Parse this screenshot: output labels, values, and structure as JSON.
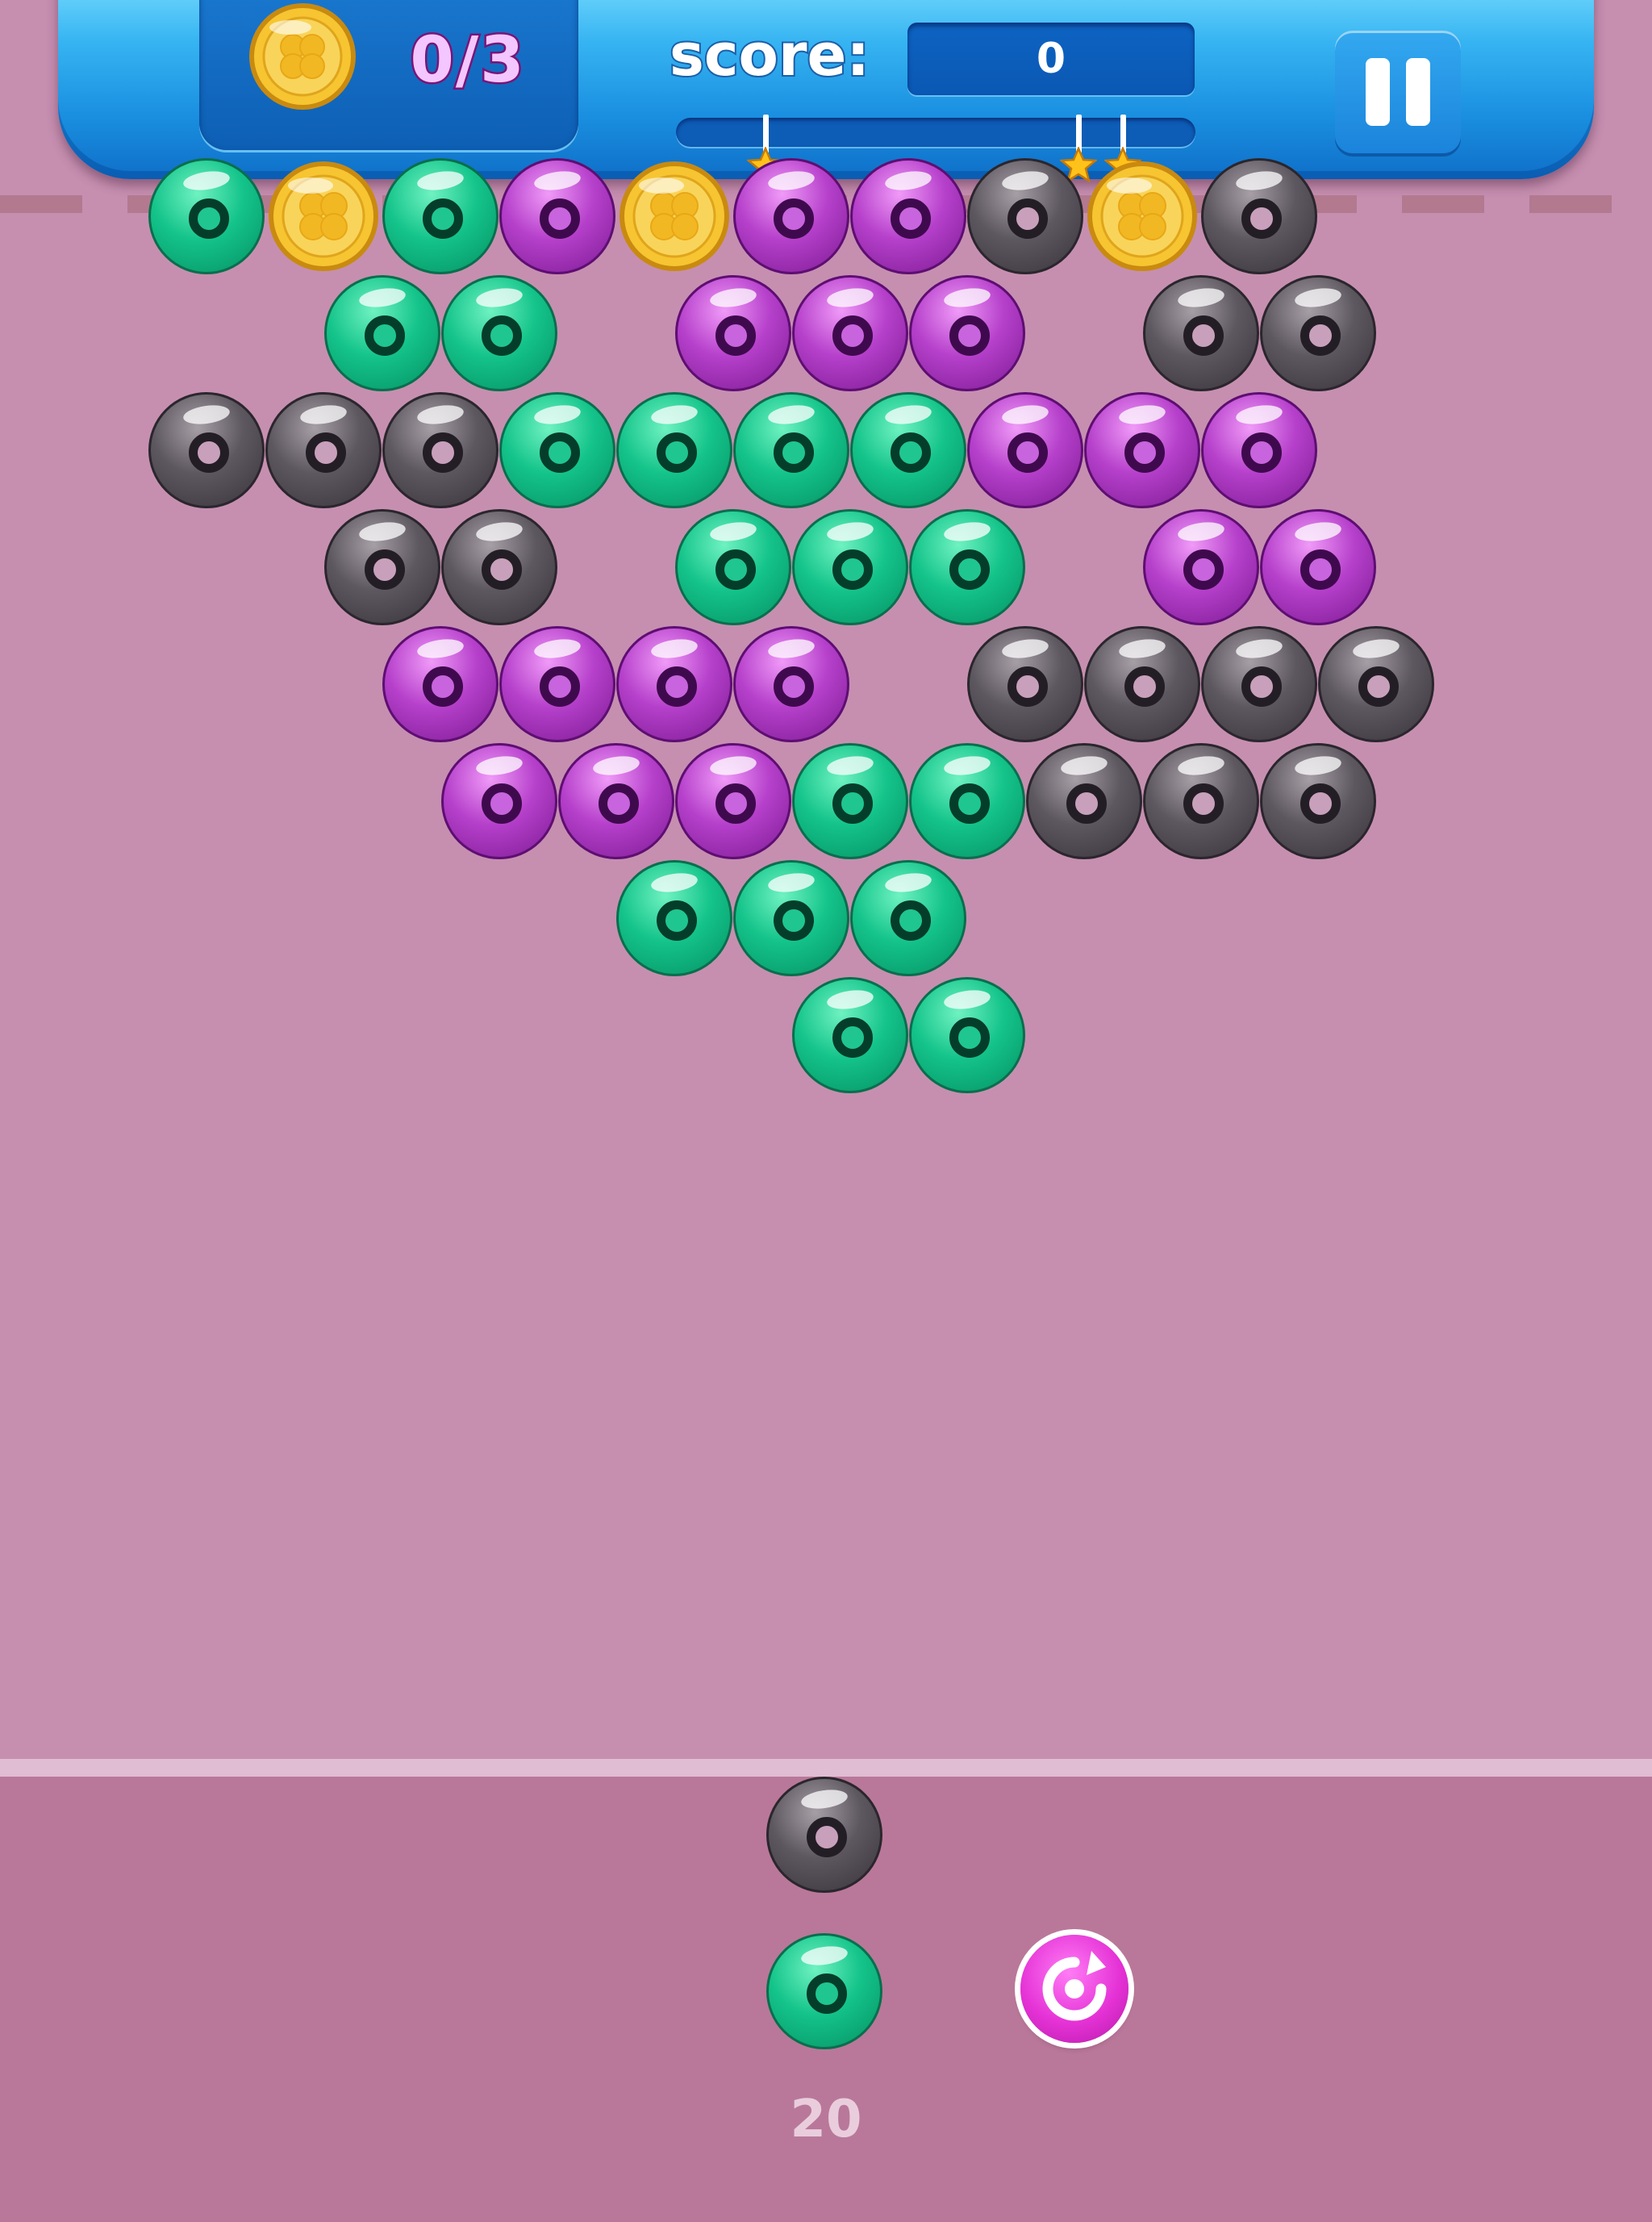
{
  "hud": {
    "coins_collected": "0/3",
    "score_label": "score:",
    "score_value": "0",
    "score_progress": 0,
    "star_thresholds": [
      3
    ]
  },
  "colors": {
    "background": "#c68fb0",
    "hud_blue": "#1a8fe0",
    "green": "#14c48a",
    "purple": "#b640cb",
    "grey": "#5d5760",
    "swap_button": "#e532d6"
  },
  "board": {
    "rows": [
      [
        "green",
        "coin",
        "green",
        "purple",
        "coin",
        "purple",
        "purple",
        "grey",
        "coin",
        "grey"
      ],
      [
        null,
        "green",
        "green",
        null,
        "purple",
        "purple",
        "purple",
        null,
        "grey",
        "grey"
      ],
      [
        "grey",
        "grey",
        "grey",
        "green",
        "green",
        "green",
        "green",
        "purple",
        "purple",
        "purple"
      ],
      [
        null,
        "grey",
        "grey",
        null,
        "green",
        "green",
        "green",
        null,
        "purple",
        "purple"
      ],
      [
        null,
        null,
        "purple",
        "purple",
        "purple",
        "purple",
        null,
        "grey",
        "grey",
        "grey",
        "grey"
      ],
      [
        null,
        null,
        "purple",
        "purple",
        "purple",
        "green",
        "green",
        "grey",
        "grey",
        "grey"
      ],
      [
        null,
        null,
        null,
        null,
        "green",
        "green",
        "green"
      ],
      [
        null,
        null,
        null,
        null,
        null,
        "green",
        "green"
      ]
    ]
  },
  "shooter": {
    "current_bubble": "grey",
    "next_bubble": "green",
    "swap_icon": "swap-icon",
    "shots_left": "20"
  },
  "icons": {
    "coin": "clover-coin-icon",
    "pause": "pause-icon",
    "star": "star-icon"
  }
}
